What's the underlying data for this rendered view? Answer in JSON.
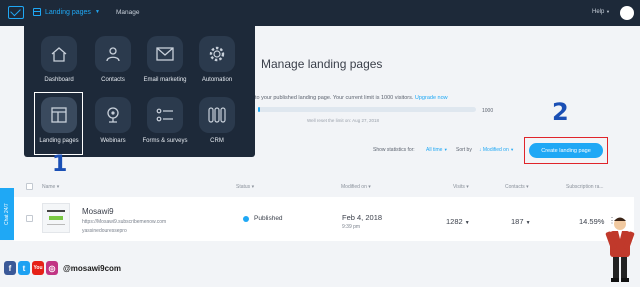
{
  "topbar": {
    "nav_main": "Landing pages",
    "nav_manage": "Manage",
    "help": "Help"
  },
  "menu": {
    "tiles": [
      {
        "label": "Dashboard",
        "icon": "house-icon"
      },
      {
        "label": "Contacts",
        "icon": "person-icon"
      },
      {
        "label": "Email marketing",
        "icon": "envelope-icon"
      },
      {
        "label": "Automation",
        "icon": "gear-icon"
      },
      {
        "label": "Landing pages",
        "icon": "layout-icon"
      },
      {
        "label": "Webinars",
        "icon": "webcam-icon"
      },
      {
        "label": "Forms & surveys",
        "icon": "list-icon"
      },
      {
        "label": "CRM",
        "icon": "columns-icon"
      }
    ]
  },
  "page": {
    "title": "Manage landing pages",
    "info_text": "to your published landing page. Your current limit is 1000 visitors.",
    "upgrade": "Upgrade now",
    "limit": "1000",
    "reset_note": "Well reset the limit on: Aug 27, 2018",
    "stats_label": "Show statistics for:",
    "stats_value": "All time",
    "sort_label": "Sort by",
    "sort_value": "Modified on",
    "create_button": "Create landing page",
    "usage_fraction": 0.01
  },
  "annotations": {
    "step1": "1",
    "step2": "2"
  },
  "table": {
    "columns": [
      "Name",
      "Status",
      "Modified on",
      "Visits",
      "Contacts",
      "Subscription ra..."
    ],
    "rows": [
      {
        "name": "Mosawi9",
        "url": "https://Mosawi9.subscribemenow.com",
        "user": "yassinedouressepro",
        "status": "Published",
        "date": "Feb 4, 2018",
        "time": "9:39 pm",
        "visits": "1282",
        "contacts": "187",
        "rate": "14.59%"
      }
    ]
  },
  "chat_tab": "Chat 24/7",
  "watermark": {
    "handle": "@mosawi9com",
    "social": [
      "f",
      "t",
      "You",
      "◎"
    ]
  },
  "colors": {
    "accent": "#1fa8f5",
    "topbar": "#1d2939",
    "highlight_red": "#e0242a",
    "annotation_blue": "#1a4fb5"
  }
}
